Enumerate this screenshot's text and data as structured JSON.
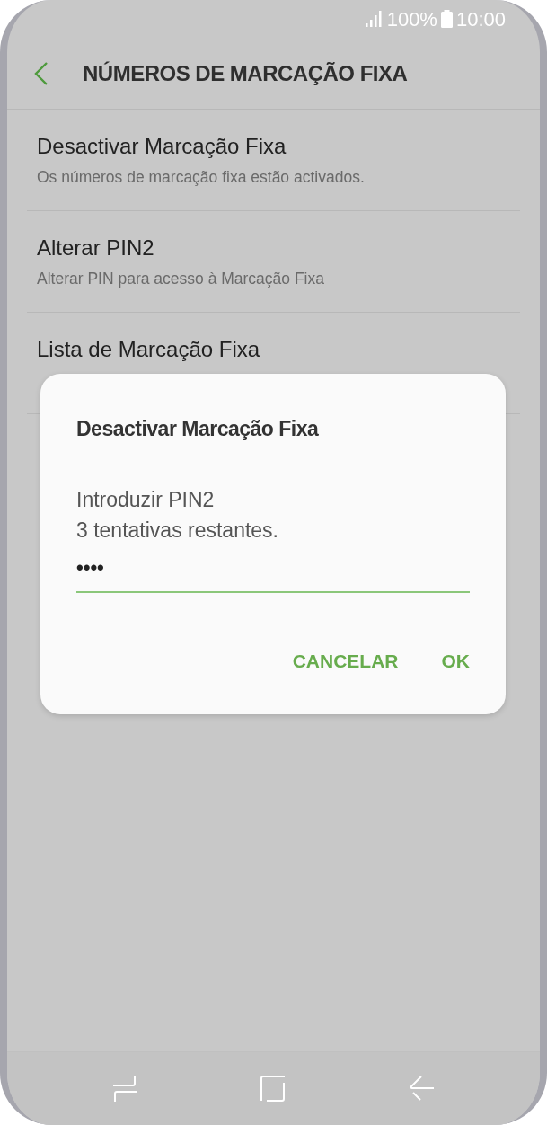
{
  "status_bar": {
    "battery": "100%",
    "time": "10:00"
  },
  "header": {
    "title": "NÚMEROS DE MARCAÇÃO FIXA"
  },
  "settings": [
    {
      "title": "Desactivar Marcação Fixa",
      "subtitle": "Os números de marcação fixa estão activados."
    },
    {
      "title": "Alterar PIN2",
      "subtitle": "Alterar PIN para acesso à Marcação Fixa"
    },
    {
      "title": "Lista de Marcação Fixa"
    }
  ],
  "dialog": {
    "title": "Desactivar Marcação Fixa",
    "message": [
      "Introduzir PIN2",
      "3 tentativas restantes."
    ],
    "pin": {
      "value": "••••"
    },
    "buttons": [
      "CANCELAR",
      "OK"
    ]
  }
}
